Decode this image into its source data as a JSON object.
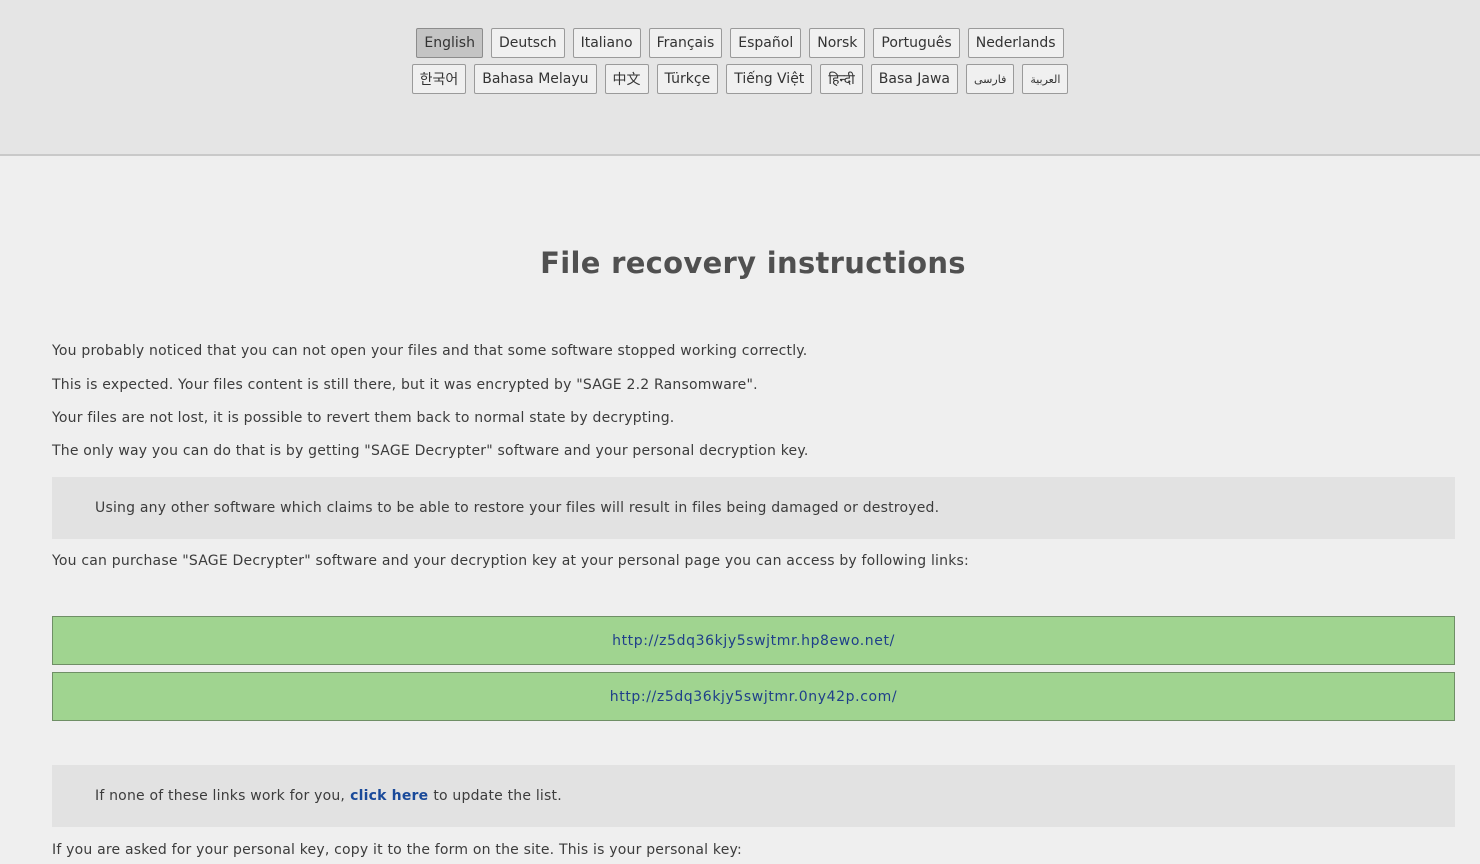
{
  "languages": {
    "row1": [
      "English",
      "Deutsch",
      "Italiano",
      "Français",
      "Español",
      "Norsk",
      "Português",
      "Nederlands"
    ],
    "row2": [
      "한국어",
      "Bahasa Melayu",
      "中文",
      "Türkçe",
      "Tiếng Việt",
      "हिन्दी",
      "Basa Jawa",
      "فارسی",
      "العربية"
    ],
    "active": "English"
  },
  "page": {
    "title": "File recovery instructions",
    "p1": "You probably noticed that you can not open your files and that some software stopped working correctly.",
    "p2": "This is expected. Your files content is still there, but it was encrypted by \"SAGE 2.2 Ransomware\".",
    "p3": "Your files are not lost, it is possible to revert them back to normal state by decrypting.",
    "p4": "The only way you can do that is by getting \"SAGE Decrypter\" software and your personal decryption key.",
    "warning": "Using any other software which claims to be able to restore your files will result in files being damaged or destroyed.",
    "p5": "You can purchase \"SAGE Decrypter\" software and your decryption key at your personal page you can access by following links:",
    "links": [
      "http://z5dq36kjy5swjtmr.hp8ewo.net/",
      "http://z5dq36kjy5swjtmr.0ny42p.com/"
    ],
    "update_prefix": "If none of these links work for you,",
    "update_link": "click here",
    "update_suffix": "to update the list.",
    "p6": "If you are asked for your personal key, copy it to the form on the site. This is your personal key:"
  },
  "colors": {
    "link_box_bg": "#a0d490",
    "link_text": "#1f3f8a",
    "notice_bg": "#e2e2e2"
  }
}
